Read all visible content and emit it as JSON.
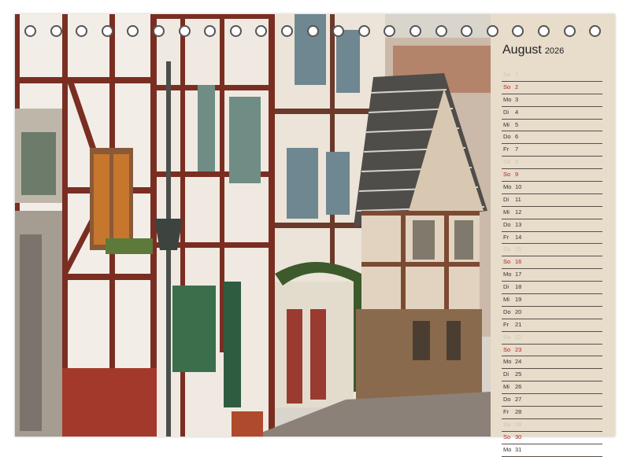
{
  "calendar": {
    "month": "August",
    "year": "2026",
    "days": [
      {
        "wd": "Sa",
        "num": "1",
        "type": "sat"
      },
      {
        "wd": "So",
        "num": "2",
        "type": "sun"
      },
      {
        "wd": "Mo",
        "num": "3",
        "type": ""
      },
      {
        "wd": "Di",
        "num": "4",
        "type": ""
      },
      {
        "wd": "Mi",
        "num": "5",
        "type": ""
      },
      {
        "wd": "Do",
        "num": "6",
        "type": ""
      },
      {
        "wd": "Fr",
        "num": "7",
        "type": ""
      },
      {
        "wd": "Sa",
        "num": "8",
        "type": "sat"
      },
      {
        "wd": "So",
        "num": "9",
        "type": "sun"
      },
      {
        "wd": "Mo",
        "num": "10",
        "type": ""
      },
      {
        "wd": "Di",
        "num": "11",
        "type": ""
      },
      {
        "wd": "Mi",
        "num": "12",
        "type": ""
      },
      {
        "wd": "Do",
        "num": "13",
        "type": ""
      },
      {
        "wd": "Fr",
        "num": "14",
        "type": ""
      },
      {
        "wd": "Sa",
        "num": "15",
        "type": "sat"
      },
      {
        "wd": "So",
        "num": "16",
        "type": "sun"
      },
      {
        "wd": "Mo",
        "num": "17",
        "type": ""
      },
      {
        "wd": "Di",
        "num": "18",
        "type": ""
      },
      {
        "wd": "Mi",
        "num": "19",
        "type": ""
      },
      {
        "wd": "Do",
        "num": "20",
        "type": ""
      },
      {
        "wd": "Fr",
        "num": "21",
        "type": ""
      },
      {
        "wd": "Sa",
        "num": "22",
        "type": "sat"
      },
      {
        "wd": "So",
        "num": "23",
        "type": "sun"
      },
      {
        "wd": "Mo",
        "num": "24",
        "type": ""
      },
      {
        "wd": "Di",
        "num": "25",
        "type": ""
      },
      {
        "wd": "Mi",
        "num": "26",
        "type": ""
      },
      {
        "wd": "Do",
        "num": "27",
        "type": ""
      },
      {
        "wd": "Fr",
        "num": "28",
        "type": ""
      },
      {
        "wd": "Sa",
        "num": "29",
        "type": "sat"
      },
      {
        "wd": "So",
        "num": "30",
        "type": "sun"
      },
      {
        "wd": "Mo",
        "num": "31",
        "type": ""
      }
    ]
  },
  "colors": {
    "sunday": "#b32020",
    "panel": "#e8dccb",
    "timber": "#7a2e22",
    "plaster": "#f1ede6"
  },
  "binding": {
    "ring_count": 23
  },
  "photo": {
    "icon": "half-timbered-street-photo"
  }
}
